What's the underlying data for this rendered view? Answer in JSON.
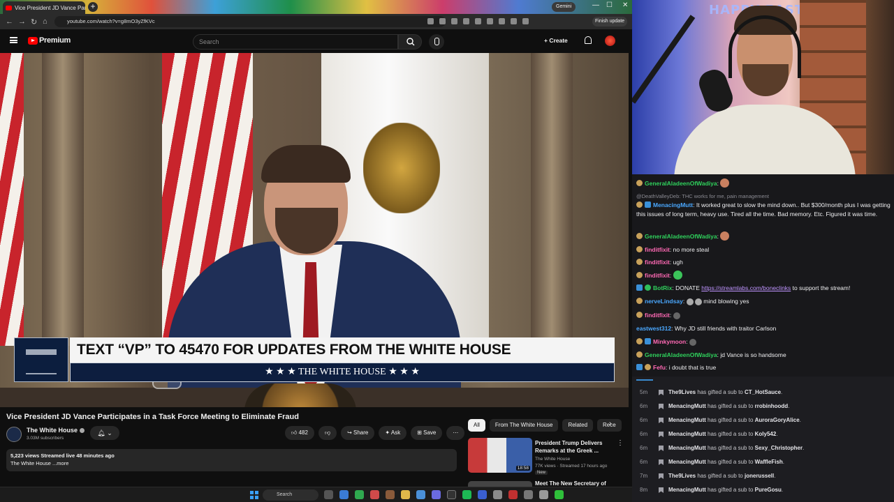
{
  "browser": {
    "tab_title": "Vice President JD Vance Partic",
    "gemini_label": "Gemini",
    "url": "youtube.com/watch?v=g8mO3yZfKVc",
    "finish_update": "Finish update"
  },
  "youtube": {
    "brand": "Premium",
    "search_placeholder": "Search",
    "create_label": "Create"
  },
  "video": {
    "banner_top": "TEXT “VP” TO 45470 FOR UPDATES FROM THE WHITE HOUSE",
    "banner_bottom": "★ ★ ★   THE WHITE HOUSE   ★ ★ ★",
    "title": "Vice President JD Vance Participates in a Task Force Meeting to Eliminate Fraud",
    "channel": "The White House",
    "subscribers": "3.03M subscribers",
    "likes": "482",
    "share": "Share",
    "ask": "Ask",
    "save": "Save",
    "views_line": "5,223 views  Streamed live 48 minutes ago",
    "desc_line": "The White House ...more"
  },
  "sidebar": {
    "chips": [
      "All",
      "From The White House",
      "Related",
      "Rece"
    ],
    "rec1": {
      "title": "President Trump Delivers Remarks at the Greek ...",
      "channel": "The White House",
      "meta": "77K views · Streamed 17 hours ago",
      "badge": "New",
      "duration": "18:58"
    },
    "rec2": {
      "title": "Meet The New Secretary of"
    }
  },
  "webcam": {
    "sign": "HAPPY EAST"
  },
  "chat": {
    "messages": [
      {
        "user": "GeneralAladeenOfWadiya",
        "color": "#2fd15c",
        "text": ""
      },
      {
        "reply": "@DeathValleyDeb: THC works for me, pain management"
      },
      {
        "user": "MenacingMutt",
        "color": "#4aa8ff",
        "text": "It worked great to slow the mind down.. But $300/month plus I was getting this issues of long term, heavy use. Tired all the time. Bad memory. Etc. Figured it was time."
      },
      {
        "user": "GeneralAladeenOfWadiya",
        "color": "#2fd15c",
        "text": ""
      },
      {
        "user": "finditfixit",
        "color": "#ff69b4",
        "text": "no more steal"
      },
      {
        "user": "finditfixit",
        "color": "#ff69b4",
        "text": "ugh"
      },
      {
        "user": "finditfixit",
        "color": "#ff69b4",
        "text": ""
      },
      {
        "user": "BotRix",
        "color": "#2fd15c",
        "text": "DONATE ",
        "link": "https://streamlabs.com/boneclinks",
        "after": " to support the stream!"
      },
      {
        "user": "nerveLindsay",
        "color": "#4aa8ff",
        "text": "mind blowing yes"
      },
      {
        "user": "finditfixit",
        "color": "#ff69b4",
        "text": ""
      },
      {
        "user": "eastwest312",
        "color": "#4aa8ff",
        "text": "Why JD still friends with traitor Carlson"
      },
      {
        "user": "Minkymoon",
        "color": "#ff69b4",
        "text": ""
      },
      {
        "user": "GeneralAladeenOfWadiya",
        "color": "#2fd15c",
        "text": "jd Vance is so handsome"
      },
      {
        "user": "Fefu",
        "color": "#ff69b4",
        "text": "i doubt that is true"
      }
    ]
  },
  "events": [
    {
      "time": "5m",
      "gifter": "The9Lives",
      "recipient": "CT_HotSauce"
    },
    {
      "time": "6m",
      "gifter": "MenacingMutt",
      "recipient": "rrobinhoodd"
    },
    {
      "time": "6m",
      "gifter": "MenacingMutt",
      "recipient": "AuroraGoryAlice"
    },
    {
      "time": "6m",
      "gifter": "MenacingMutt",
      "recipient": "Koly542"
    },
    {
      "time": "6m",
      "gifter": "MenacingMutt",
      "recipient": "Sexy_Christopher"
    },
    {
      "time": "6m",
      "gifter": "MenacingMutt",
      "recipient": "WaffleFish"
    },
    {
      "time": "7m",
      "gifter": "The9Lives",
      "recipient": "jonerussell"
    },
    {
      "time": "8m",
      "gifter": "MenacingMutt",
      "recipient": "PureGosu"
    }
  ],
  "event_text": "has gifted a sub to",
  "taskbar": {
    "search": "Search"
  }
}
